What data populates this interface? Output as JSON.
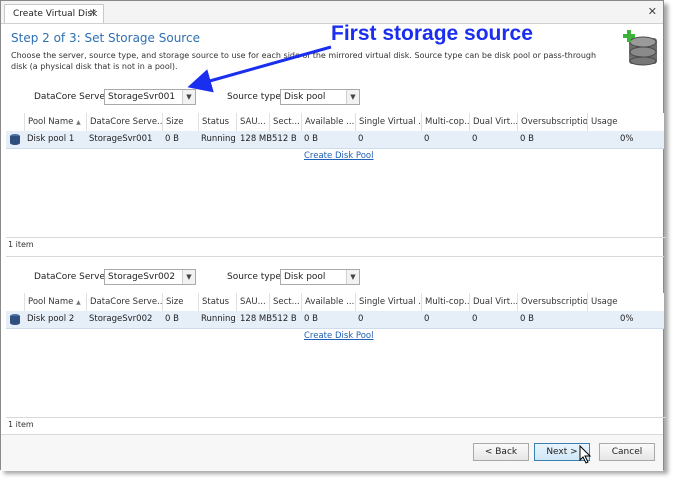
{
  "window": {
    "tab_title": "Create Virtual Disk",
    "tab_close": "✕",
    "window_close": "✕"
  },
  "header": {
    "step_title": "Step 2 of 3: Set Storage Source",
    "description": "Choose the server, source type, and storage source to use for each side of the mirrored virtual disk. Source type can be disk pool or pass-through disk (a physical disk that is not in a pool)."
  },
  "annotation": {
    "text": "First storage source",
    "color": "#1a2ef0"
  },
  "labels": {
    "server": "DataCore Server:",
    "source_type": "Source type:",
    "create_link": "Create Disk Pool"
  },
  "columns": [
    "Pool Name",
    "DataCore Serve...",
    "Size",
    "Status",
    "SAU...",
    "Sect...",
    "Available ...",
    "Single Virtual ...",
    "Multi-cop...",
    "Dual Virt...",
    "Oversubscription",
    "Usage"
  ],
  "sources": [
    {
      "server": "StorageSvr001",
      "source_type": "Disk pool",
      "row": [
        "Disk pool 1",
        "StorageSvr001",
        "0 B",
        "Running",
        "128 MB",
        "512 B",
        "0 B",
        "0",
        "0",
        "0",
        "0 B",
        "0%"
      ],
      "footer": "1 item"
    },
    {
      "server": "StorageSvr002",
      "source_type": "Disk pool",
      "row": [
        "Disk pool 2",
        "StorageSvr002",
        "0 B",
        "Running",
        "128 MB",
        "512 B",
        "0 B",
        "0",
        "0",
        "0",
        "0 B",
        "0%"
      ],
      "footer": "1 item"
    }
  ],
  "buttons": {
    "back": "< Back",
    "next": "Next >",
    "cancel": "Cancel"
  },
  "colors": {
    "accent": "#2e6fb4",
    "selection": "#e6eef8",
    "link": "#1f5fb5"
  }
}
